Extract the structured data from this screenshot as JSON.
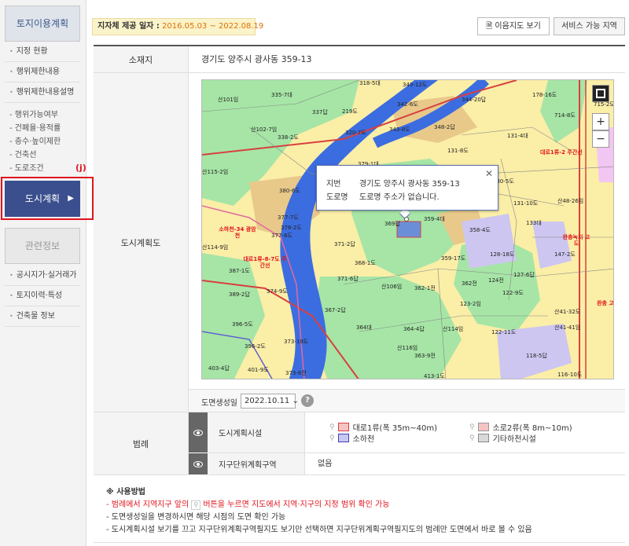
{
  "sidebar": {
    "section1_title": "토지이용계획",
    "items": [
      "지정 현황",
      "행위제한내용",
      "행위제한내용설명"
    ],
    "sub_items": [
      "행위가능여부",
      "건폐율·용적률",
      "층수·높이제한",
      "건축선",
      "도로조건"
    ],
    "active": "도시계획",
    "marker": "(j)",
    "section2_title": "관련정보",
    "items2": [
      "공시지가·실거래가",
      "토지이력·특성",
      "건축물 정보"
    ]
  },
  "topbar": {
    "date_label": "지자체 제공 일자 :",
    "date_value": "2016.05.03 ~ 2022.08.19",
    "btn_map": "이음지도 보기",
    "btn_area": "서비스 가능 지역"
  },
  "table": {
    "addr_label": "소재지",
    "addr_value": "경기도 양주시 광사동 359-13",
    "map_label": "도시계획도",
    "gen_label": "도면생성일",
    "gen_value": "2022.10.11",
    "legend_label": "범례",
    "facility_label": "도시계획시설",
    "district_label": "지구단위계획구역",
    "district_value": "없음"
  },
  "legend_items": [
    {
      "label": "대로1류(폭 35m~40m)",
      "fill": "#f6c3c3",
      "stroke": "#d84040"
    },
    {
      "label": "소로2류(폭 8m~10m)",
      "fill": "#f6c3c3",
      "stroke": "#999999"
    },
    {
      "label": "소하천",
      "fill": "#c8c8f0",
      "stroke": "#4040c0"
    },
    {
      "label": "기타하천시설",
      "fill": "#d9d9d9",
      "stroke": "#888888"
    }
  ],
  "popup": {
    "lot_key": "지번",
    "lot_value": "경기도 양주시 광사동 359-13",
    "road_key": "도로명",
    "road_value": "도로명 주소가 없습니다."
  },
  "map_labels": {
    "lots": [
      "318-5대",
      "343-12도",
      "344-20답",
      "178-16도",
      "산101임",
      "335-7대",
      "337답",
      "219도",
      "342-6도",
      "산102-7임",
      "320-7도",
      "343-8도",
      "348-2답",
      "131-4대",
      "338-2도",
      "131-8도",
      "산115-2임",
      "379-1대",
      "380-6도",
      "130-5도",
      "131-10도",
      "산48-26임",
      "377-7도",
      "369답",
      "359-4대",
      "133대",
      "378-2도",
      "358-4도",
      "377-8도",
      "371-2답",
      "128-18도",
      "147-2도",
      "산114-9임",
      "368-1도",
      "359-17도",
      "387-1도",
      "371-6답",
      "127-6답",
      "산106임",
      "362-1전",
      "362전",
      "124전",
      "389-2답",
      "374-9도",
      "122-9도",
      "123-2임",
      "367-2답",
      "산41-32도",
      "산41-41임",
      "396-5도",
      "364대",
      "364-4답",
      "산114임",
      "122-11도",
      "373-19도",
      "산116임",
      "118-5답",
      "396-2도",
      "363-9전",
      "403-4답",
      "401-9도",
      "373-6전",
      "413-1도",
      "116-10도",
      "715-2도",
      "714-8도"
    ],
    "roads": [
      "대로1류-2 주간선",
      "대로1류-8-7도 주간선",
      "소하천-34 광암천",
      "완충녹지 고도",
      "완충 고"
    ]
  },
  "notes": {
    "title": "※ 사용방법",
    "line1_pre": "- 범례에서 지역지구 앞의",
    "line1_post": "버튼을 누르면 지도에서 지역·지구의 지정 범위 확인 가능",
    "line2": "- 도면생성일을 변경하시면 해당 시점의 도면 확인 가능",
    "line3": "- 도시계획시설 보기를 끄고 지구단위계획구역필지도 보기만 선택하면 지구단위계획구역필지도의 범례만 도면에서 바로 볼 수 있음"
  },
  "colors": {
    "sidebar_active": "#3b4f8e",
    "highlight_red": "#e0141e",
    "date_value": "#e07000",
    "map_green": "#a6e5a6",
    "map_yellow": "#fbeea7",
    "map_river": "#3c6de0"
  }
}
